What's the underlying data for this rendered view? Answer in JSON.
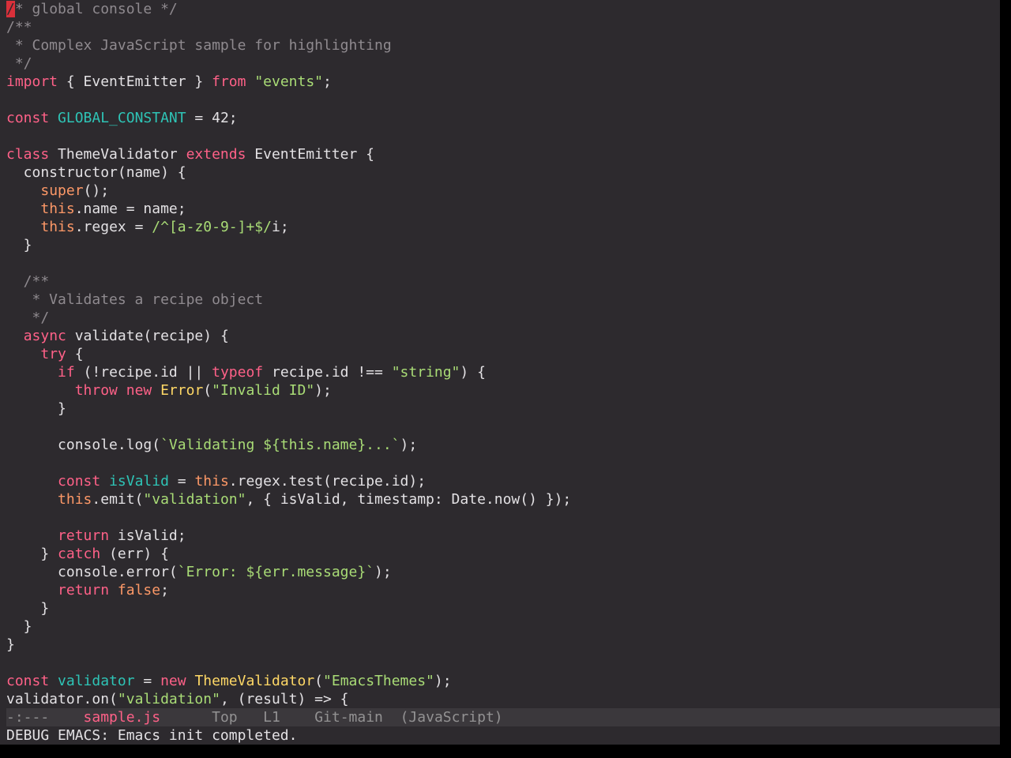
{
  "editor": {
    "lines": [
      [
        {
          "t": "/",
          "c": "cursor"
        },
        {
          "t": "* global console */",
          "c": "cmt"
        }
      ],
      [
        {
          "t": "/**",
          "c": "cmt"
        }
      ],
      [
        {
          "t": " * Complex JavaScript sample for highlighting",
          "c": "cmt"
        }
      ],
      [
        {
          "t": " */",
          "c": "cmt"
        }
      ],
      [
        {
          "t": "import",
          "c": "kw"
        },
        {
          "t": " { EventEmitter } "
        },
        {
          "t": "from",
          "c": "kw"
        },
        {
          "t": " "
        },
        {
          "t": "\"events\"",
          "c": "str"
        },
        {
          "t": ";"
        }
      ],
      [],
      [
        {
          "t": "const",
          "c": "kw"
        },
        {
          "t": " "
        },
        {
          "t": "GLOBAL_CONSTANT",
          "c": "def"
        },
        {
          "t": " = 42;"
        }
      ],
      [],
      [
        {
          "t": "class",
          "c": "kw"
        },
        {
          "t": " ThemeValidator "
        },
        {
          "t": "extends",
          "c": "kw"
        },
        {
          "t": " EventEmitter {"
        }
      ],
      [
        {
          "t": "  constructor(name) {"
        }
      ],
      [
        {
          "t": "    "
        },
        {
          "t": "super",
          "c": "bi"
        },
        {
          "t": "();"
        }
      ],
      [
        {
          "t": "    "
        },
        {
          "t": "this",
          "c": "bi"
        },
        {
          "t": ".name = name;"
        }
      ],
      [
        {
          "t": "    "
        },
        {
          "t": "this",
          "c": "bi"
        },
        {
          "t": ".regex = "
        },
        {
          "t": "/^[a-z0-9-]+$/",
          "c": "str"
        },
        {
          "t": "i;"
        }
      ],
      [
        {
          "t": "  }"
        }
      ],
      [],
      [
        {
          "t": "  /**",
          "c": "cmt"
        }
      ],
      [
        {
          "t": "   * Validates a recipe object",
          "c": "cmt"
        }
      ],
      [
        {
          "t": "   */",
          "c": "cmt"
        }
      ],
      [
        {
          "t": "  "
        },
        {
          "t": "async",
          "c": "kw"
        },
        {
          "t": " validate(recipe) {"
        }
      ],
      [
        {
          "t": "    "
        },
        {
          "t": "try",
          "c": "kw"
        },
        {
          "t": " {"
        }
      ],
      [
        {
          "t": "      "
        },
        {
          "t": "if",
          "c": "kw"
        },
        {
          "t": " (!recipe.id || "
        },
        {
          "t": "typeof",
          "c": "kw"
        },
        {
          "t": " recipe.id !== "
        },
        {
          "t": "\"string\"",
          "c": "str"
        },
        {
          "t": ") {"
        }
      ],
      [
        {
          "t": "        "
        },
        {
          "t": "throw",
          "c": "kw"
        },
        {
          "t": " "
        },
        {
          "t": "new",
          "c": "kw"
        },
        {
          "t": " "
        },
        {
          "t": "Error",
          "c": "cls"
        },
        {
          "t": "("
        },
        {
          "t": "\"Invalid ID\"",
          "c": "str"
        },
        {
          "t": ");"
        }
      ],
      [
        {
          "t": "      }"
        }
      ],
      [],
      [
        {
          "t": "      console.log("
        },
        {
          "t": "`Validating ${this.name}...`",
          "c": "str"
        },
        {
          "t": ");"
        }
      ],
      [],
      [
        {
          "t": "      "
        },
        {
          "t": "const",
          "c": "kw"
        },
        {
          "t": " "
        },
        {
          "t": "isValid",
          "c": "def"
        },
        {
          "t": " = "
        },
        {
          "t": "this",
          "c": "bi"
        },
        {
          "t": ".regex.test(recipe.id);"
        }
      ],
      [
        {
          "t": "      "
        },
        {
          "t": "this",
          "c": "bi"
        },
        {
          "t": ".emit("
        },
        {
          "t": "\"validation\"",
          "c": "str"
        },
        {
          "t": ", { isValid, timestamp: Date.now() });"
        }
      ],
      [],
      [
        {
          "t": "      "
        },
        {
          "t": "return",
          "c": "kw"
        },
        {
          "t": " isValid;"
        }
      ],
      [
        {
          "t": "    } "
        },
        {
          "t": "catch",
          "c": "kw"
        },
        {
          "t": " (err) {"
        }
      ],
      [
        {
          "t": "      console.error("
        },
        {
          "t": "`Error: ${err.message}`",
          "c": "str"
        },
        {
          "t": ");"
        }
      ],
      [
        {
          "t": "      "
        },
        {
          "t": "return",
          "c": "kw"
        },
        {
          "t": " "
        },
        {
          "t": "false",
          "c": "bi"
        },
        {
          "t": ";"
        }
      ],
      [
        {
          "t": "    }"
        }
      ],
      [
        {
          "t": "  }"
        }
      ],
      [
        {
          "t": "}"
        }
      ],
      [],
      [
        {
          "t": "const",
          "c": "kw"
        },
        {
          "t": " "
        },
        {
          "t": "validator",
          "c": "def"
        },
        {
          "t": " = "
        },
        {
          "t": "new",
          "c": "kw"
        },
        {
          "t": " "
        },
        {
          "t": "ThemeValidator",
          "c": "cls"
        },
        {
          "t": "("
        },
        {
          "t": "\"EmacsThemes\"",
          "c": "str"
        },
        {
          "t": ");"
        }
      ],
      [
        {
          "t": "validator.on("
        },
        {
          "t": "\"validation\"",
          "c": "str"
        },
        {
          "t": ", (result) => {"
        }
      ]
    ]
  },
  "modeline": {
    "status": "-:---",
    "filename": "sample.js",
    "position": "Top",
    "line": "L1",
    "vc": "Git-main",
    "mode": "(JavaScript)"
  },
  "echo_area": {
    "message": "DEBUG EMACS: Emacs init completed."
  },
  "colors": {
    "background": "#2d2a2e",
    "keyword": "#ff6188",
    "builtin": "#fc9867",
    "string": "#a9dc76",
    "comment": "#8f8a8f",
    "definition": "#2ec4b6",
    "type": "#ffd866",
    "cursor": "#d9303a"
  }
}
